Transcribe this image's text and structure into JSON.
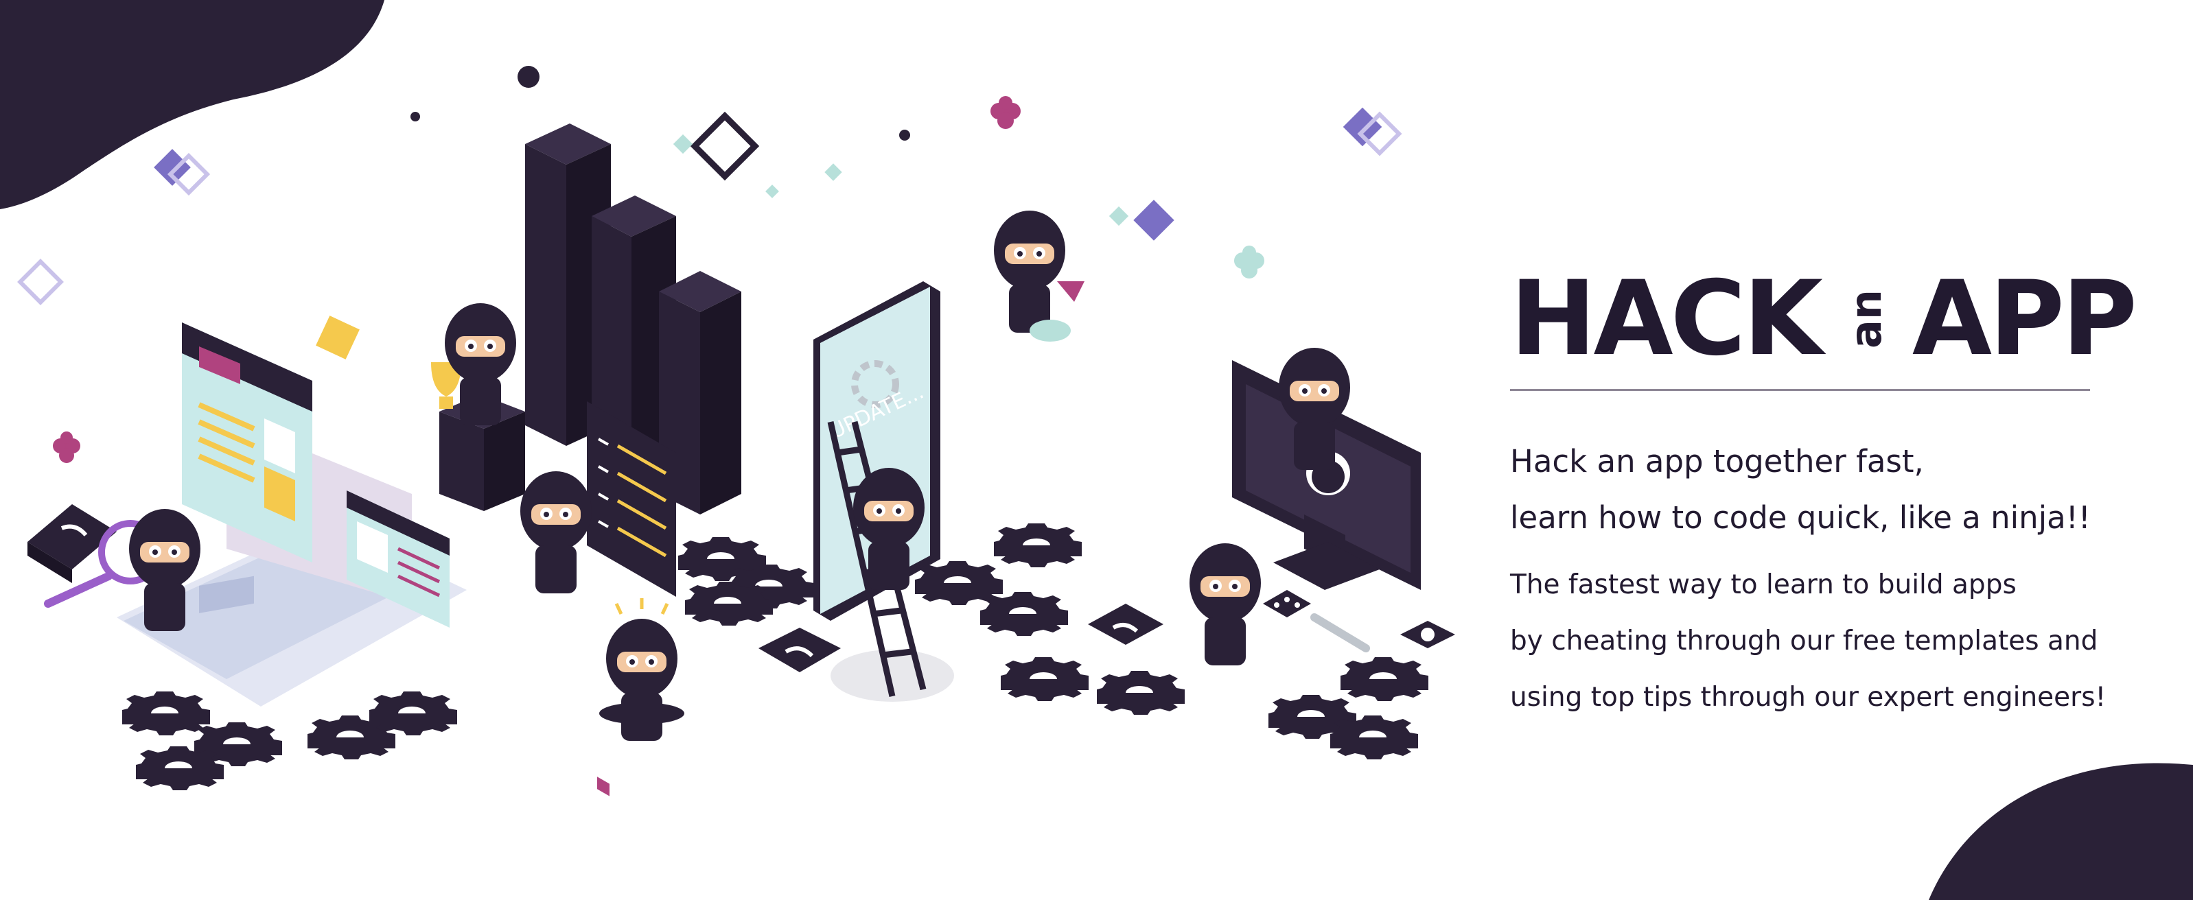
{
  "brand": {
    "title_part1": "HACK",
    "title_part2": "an",
    "title_part3": "APP",
    "primary_color": "#2a2137",
    "accent_color": "#7a6fc4",
    "secondary_accent": "#b0437f",
    "highlight_color": "#f5c94d"
  },
  "headline": {
    "line1": "Hack an app together fast,",
    "line2": "learn how to code quick, like a ninja!!"
  },
  "description": {
    "line1": "The fastest way to learn to build apps",
    "line2": "by cheating through our free templates and",
    "line3": "using top tips through our expert engineers!"
  },
  "illustration": {
    "phone_screen_text": "UPDATE...",
    "icons": [
      "ninja-icon",
      "gear-icon",
      "trophy-icon",
      "wifi-icon",
      "ladder-icon",
      "laptop-icon",
      "monitor-icon",
      "smartphone-icon",
      "bar-chart-icon",
      "checklist-icon",
      "wrench-icon",
      "chat-icon"
    ]
  }
}
